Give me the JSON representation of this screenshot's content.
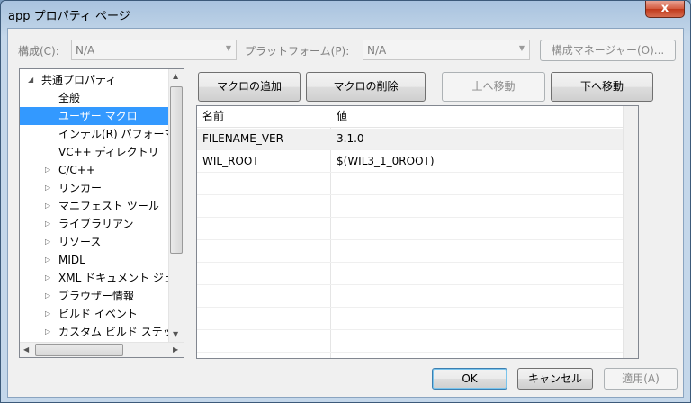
{
  "window": {
    "title": "app プロパティ ページ",
    "close_symbol": "x"
  },
  "config_row": {
    "config_label": "構成(C):",
    "config_value": "N/A",
    "platform_label": "プラットフォーム(P):",
    "platform_value": "N/A",
    "manager_button": "構成マネージャー(O)..."
  },
  "tree": {
    "items": [
      {
        "label": "共通プロパティ",
        "arrow": "◢"
      },
      {
        "label": "全般"
      },
      {
        "label": "ユーザー マクロ"
      },
      {
        "label": "インテル(R) パフォーマンス"
      },
      {
        "label": "VC++ ディレクトリ"
      },
      {
        "label": "C/C++",
        "arrow": "▷"
      },
      {
        "label": "リンカー",
        "arrow": "▷"
      },
      {
        "label": "マニフェスト ツール",
        "arrow": "▷"
      },
      {
        "label": "ライブラリアン",
        "arrow": "▷"
      },
      {
        "label": "リソース",
        "arrow": "▷"
      },
      {
        "label": "MIDL",
        "arrow": "▷"
      },
      {
        "label": "XML ドキュメント ジェネ",
        "arrow": "▷"
      },
      {
        "label": "ブラウザー情報",
        "arrow": "▷"
      },
      {
        "label": "ビルド イベント",
        "arrow": "▷"
      },
      {
        "label": "カスタム ビルド ステップ",
        "arrow": "▷"
      }
    ]
  },
  "toolbar": {
    "add_macro": "マクロの追加",
    "delete_macro": "マクロの削除",
    "move_up": "上へ移動",
    "move_down": "下へ移動"
  },
  "grid": {
    "columns": [
      "名前",
      "値"
    ],
    "rows": [
      {
        "name": "FILENAME_VER",
        "value": "3.1.0"
      },
      {
        "name": "WIL_ROOT",
        "value": "$(WIL3_1_0ROOT)"
      }
    ]
  },
  "footer": {
    "ok": "OK",
    "cancel": "キャンセル",
    "apply": "適用(A)"
  }
}
